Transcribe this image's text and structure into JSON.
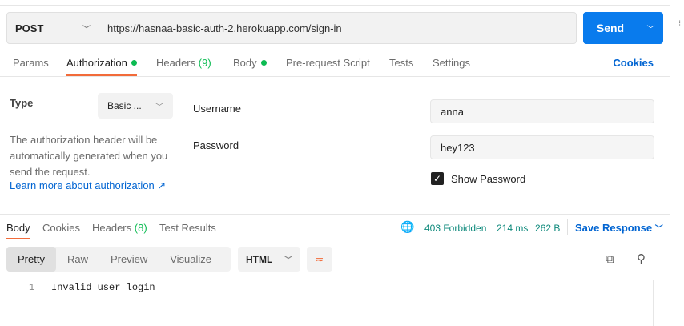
{
  "request": {
    "method": "POST",
    "url": "https://hasnaa-basic-auth-2.herokuapp.com/sign-in",
    "send_label": "Send"
  },
  "tabs": {
    "params": "Params",
    "authorization": "Authorization",
    "headers": "Headers",
    "headers_count": "(9)",
    "body": "Body",
    "prerequest": "Pre-request Script",
    "tests": "Tests",
    "settings": "Settings",
    "cookies": "Cookies"
  },
  "auth": {
    "type_label": "Type",
    "type_value": "Basic ...",
    "description": "The authorization header will be automatically generated when you send the request.",
    "learn_more": "Learn more about authorization ↗",
    "username_label": "Username",
    "username_value": "anna",
    "password_label": "Password",
    "password_value": "hey123",
    "show_password_label": "Show Password",
    "show_password_checked": true
  },
  "response": {
    "tabs": {
      "body": "Body",
      "cookies": "Cookies",
      "headers": "Headers",
      "headers_count": "(8)",
      "test_results": "Test Results"
    },
    "status": "403 Forbidden",
    "time": "214 ms",
    "size": "262 B",
    "save_response": "Save Response",
    "views": [
      "Pretty",
      "Raw",
      "Preview",
      "Visualize"
    ],
    "format": "HTML",
    "lines": [
      {
        "num": "1",
        "text": "Invalid user login"
      }
    ]
  },
  "colors": {
    "accent": "#097bed",
    "active_tab": "#f26b3a",
    "status": "#0f8a7c"
  }
}
